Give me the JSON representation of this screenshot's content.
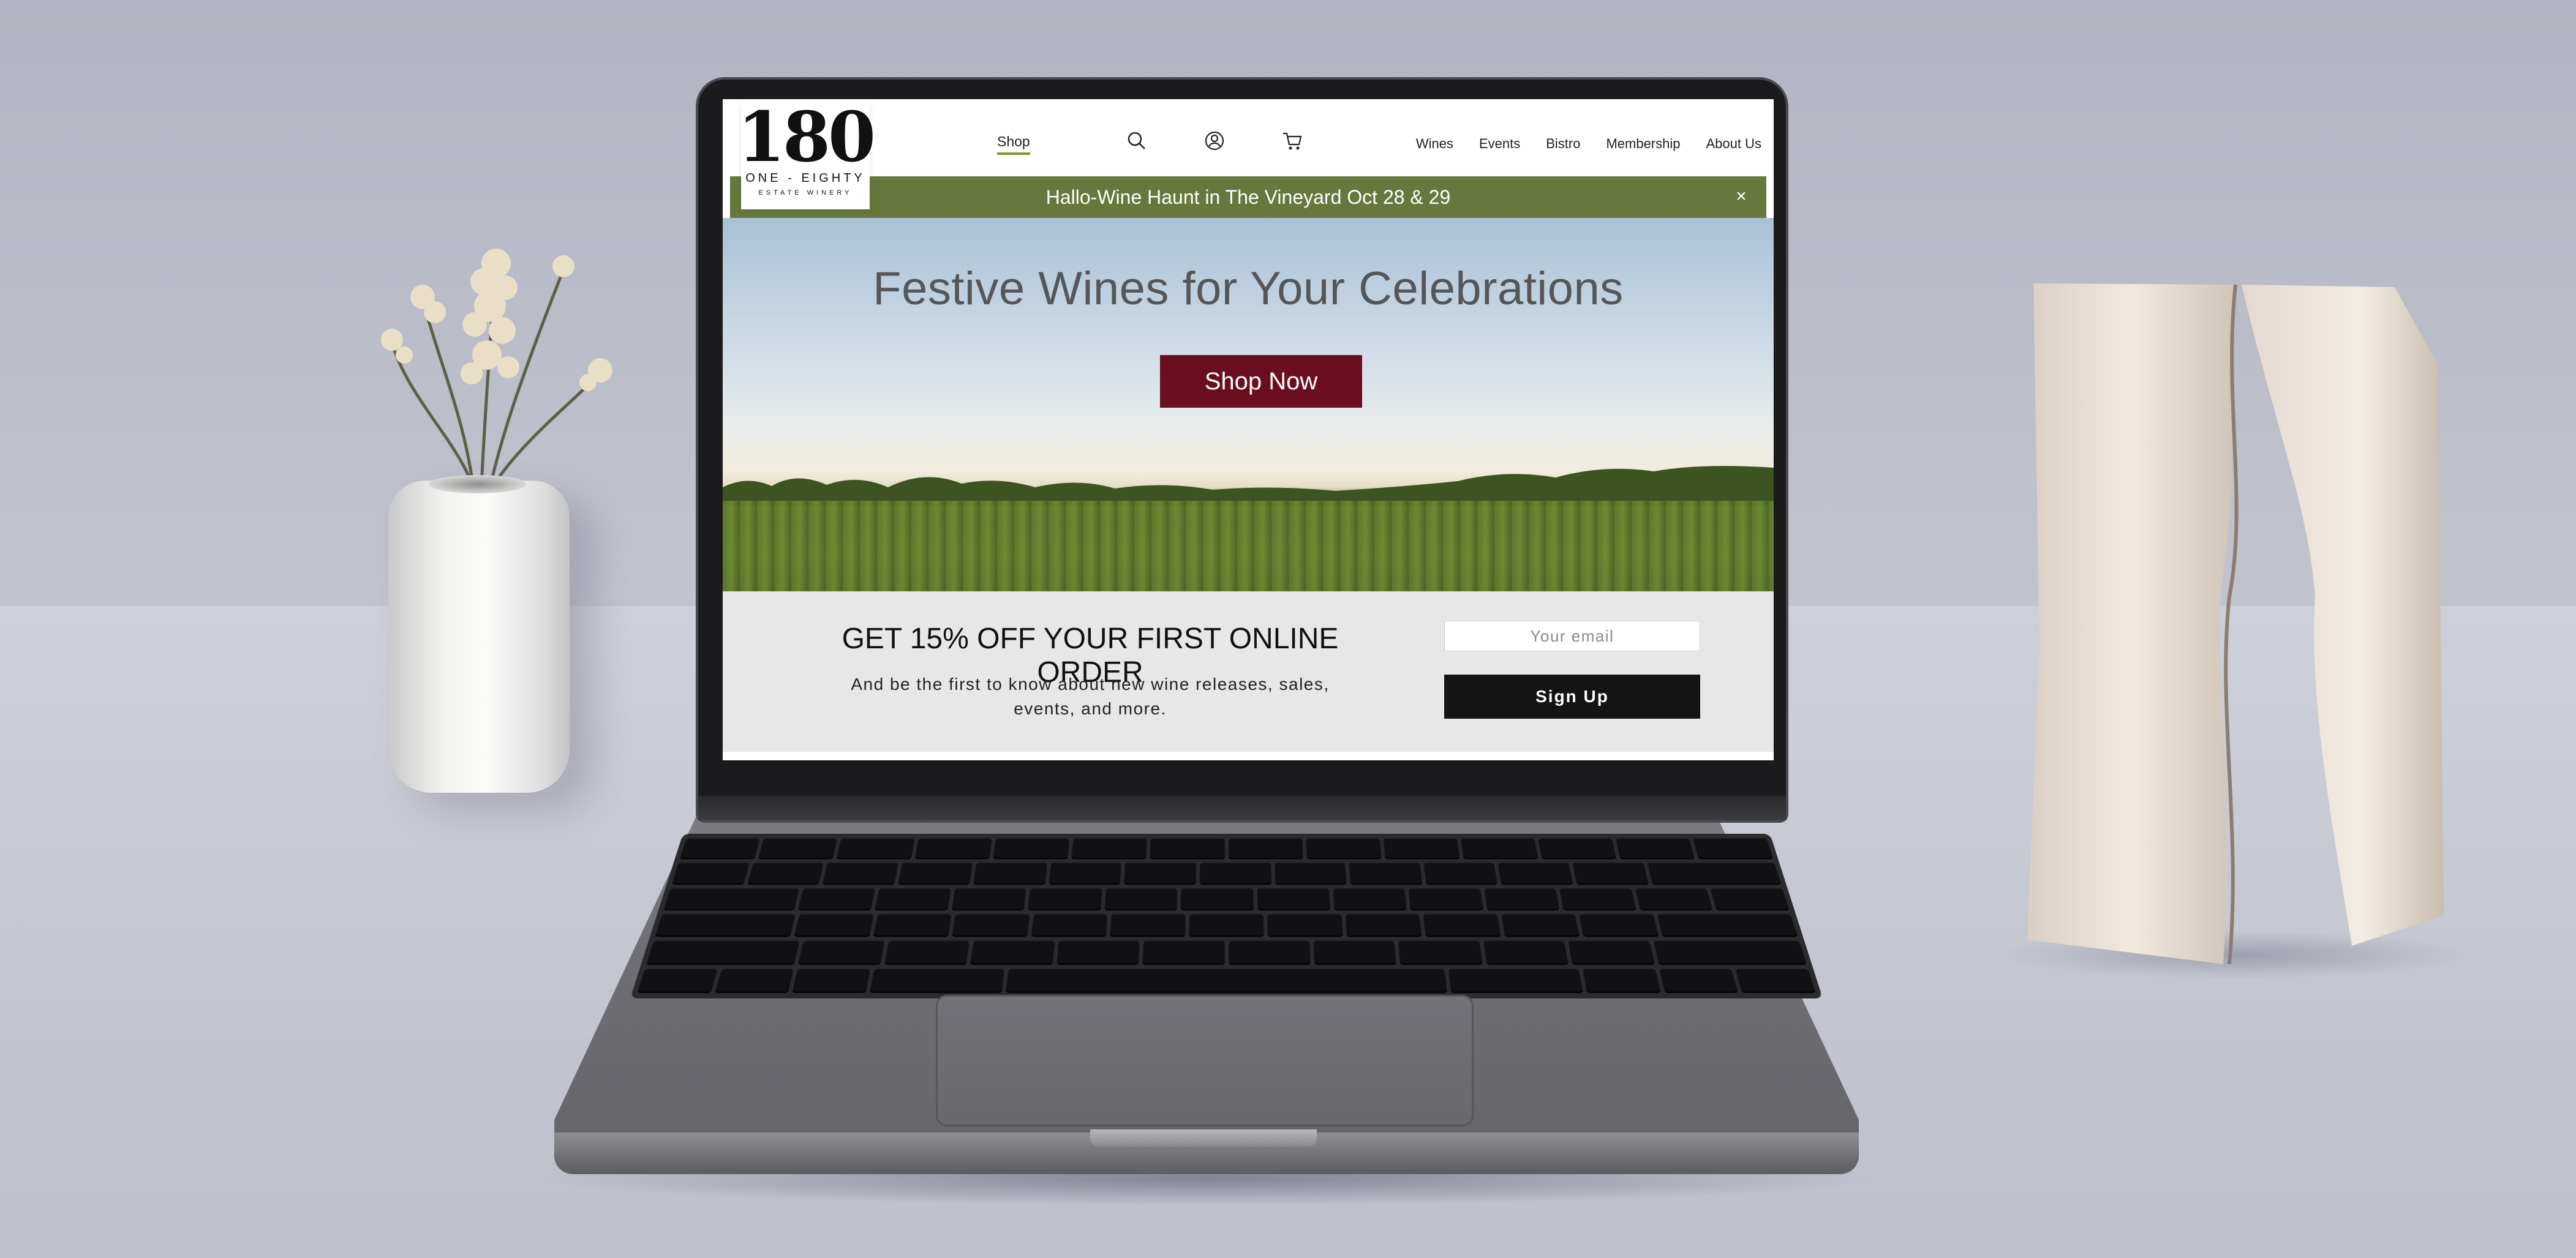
{
  "site": {
    "logo": {
      "number": "180",
      "name": "ONE - EIGHTY",
      "subtitle": "ESTATE WINERY"
    },
    "nav": {
      "shop_label": "Shop",
      "icons": [
        "search-icon",
        "account-icon",
        "cart-icon"
      ],
      "items": [
        "Wines",
        "Events",
        "Bistro",
        "Membership",
        "About Us"
      ]
    },
    "announcement": {
      "text": "Hallo-Wine Haunt in The Vineyard Oct 28 & 29",
      "close_icon": "close-icon"
    },
    "hero": {
      "title": "Festive Wines for Your Celebrations",
      "button_label": "Shop Now"
    },
    "promo": {
      "title": "GET 15% OFF YOUR FIRST ONLINE ORDER",
      "subtitle_line1": "And be the first to know about new wine releases, sales,",
      "subtitle_line2": "events, and more.",
      "email_placeholder": "Your email",
      "email_value": "",
      "signup_label": "Sign Up"
    },
    "colors": {
      "announcement_bg": "#67783c",
      "hero_button_bg": "#6b0e22",
      "shop_underline": "#7a9a1e",
      "signup_bg": "#141414"
    }
  }
}
